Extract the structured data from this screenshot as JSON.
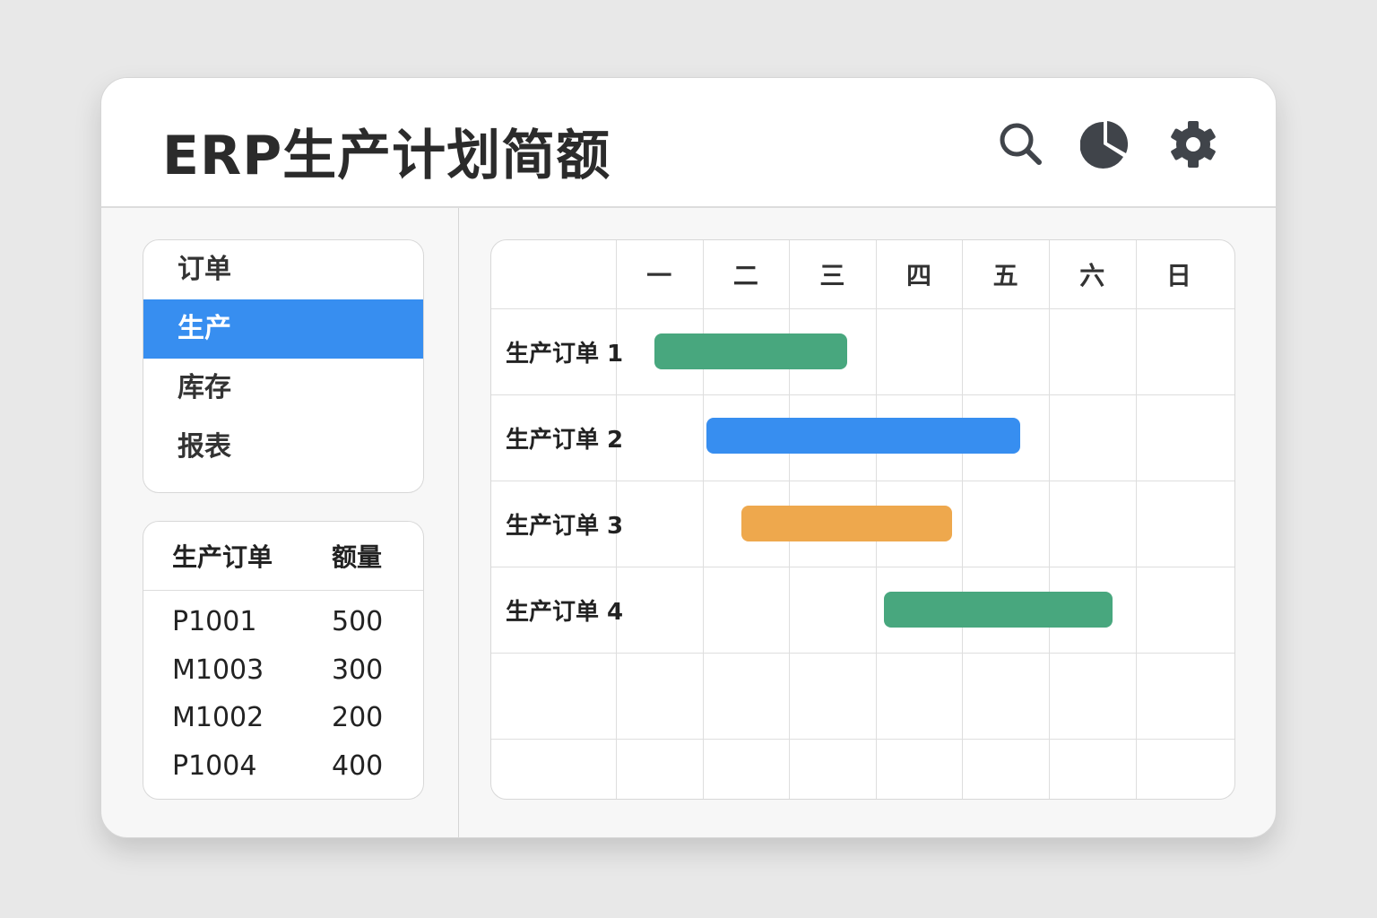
{
  "header": {
    "title": "ERP生产计划简额",
    "icons": [
      "search-icon",
      "pie-chart-icon",
      "gear-icon"
    ]
  },
  "nav": {
    "items": [
      {
        "label": "订单"
      },
      {
        "label": "生产",
        "active": true
      },
      {
        "label": "库存"
      },
      {
        "label": "报表"
      }
    ]
  },
  "orders_table": {
    "headers": [
      "生产订单",
      "额量"
    ],
    "rows": [
      [
        "P1001",
        "500"
      ],
      [
        "M1003",
        "300"
      ],
      [
        "M1002",
        "200"
      ],
      [
        "P1004",
        "400"
      ]
    ]
  },
  "gantt": {
    "days": [
      "一",
      "二",
      "三",
      "四",
      "五",
      "六",
      "日"
    ],
    "tasks": [
      {
        "label": "生产订单 1",
        "start": 0.45,
        "end": 2.67,
        "color": "#48a77e"
      },
      {
        "label": "生产订单 2",
        "start": 1.05,
        "end": 4.67,
        "color": "#378ef0"
      },
      {
        "label": "生产订单 3",
        "start": 1.45,
        "end": 3.88,
        "color": "#eea84d"
      },
      {
        "label": "生产订单 4",
        "start": 3.1,
        "end": 5.73,
        "color": "#48a77e"
      }
    ]
  }
}
